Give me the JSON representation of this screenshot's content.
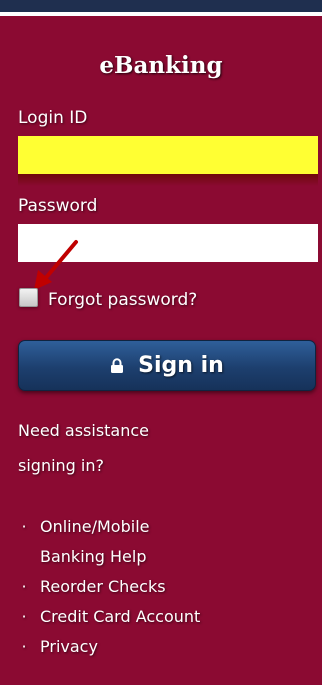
{
  "panel": {
    "title": "eBanking",
    "background_color": "#8b0a32"
  },
  "login": {
    "label": "Login ID",
    "value": "",
    "field_color": "#ffff33"
  },
  "password": {
    "label": "Password",
    "value": ""
  },
  "forgot": {
    "label": "Forgot password?",
    "checked": false
  },
  "signin": {
    "label": "Sign in",
    "icon": "lock-icon",
    "button_color": "#1d3f6e"
  },
  "assistance": {
    "line1": "Need assistance",
    "line2": "signing in?"
  },
  "links": [
    {
      "bullet": "·",
      "line1": "Online/Mobile",
      "line2": "Banking Help"
    },
    {
      "bullet": "·",
      "line1": "Reorder Checks"
    },
    {
      "bullet": "·",
      "line1": "Credit Card Account"
    },
    {
      "bullet": "·",
      "line1": "Privacy"
    }
  ],
  "annotation": {
    "arrow_color": "#c00000"
  }
}
